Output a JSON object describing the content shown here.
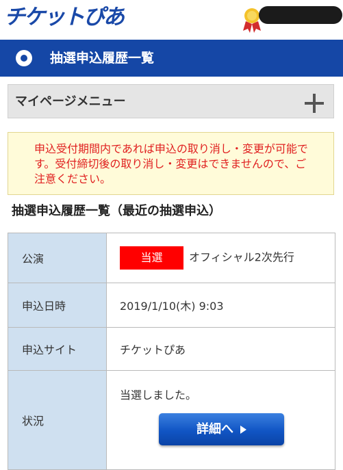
{
  "header": {
    "logo_text": "チケットぴあ",
    "medal_icon": "medal-icon"
  },
  "titlebar": {
    "title": "抽選申込履歴一覧"
  },
  "mypage_menu": {
    "label": "マイページメニュー",
    "expand_icon": "plus-icon"
  },
  "notice": {
    "text": "申込受付期間内であれば申込の取り消し・変更が可能です。受付締切後の取り消し・変更はできませんので、ご注意ください。"
  },
  "section": {
    "title": "抽選申込履歴一覧（最近の抽選申込）"
  },
  "table": {
    "rows": [
      {
        "key": "公演",
        "badge": "当選",
        "value": "オフィシャル2次先行"
      },
      {
        "key": "申込日時",
        "value": "2019/1/10(木) 9:03"
      },
      {
        "key": "申込サイト",
        "value": "チケットぴあ"
      },
      {
        "key": "状況",
        "value": "当選しました。",
        "button": "詳細へ"
      }
    ]
  },
  "colors": {
    "brand_blue": "#1547a6",
    "win_badge": "#ff0000",
    "notice_text": "#e02020",
    "key_cell_bg": "#cfe0f0"
  }
}
